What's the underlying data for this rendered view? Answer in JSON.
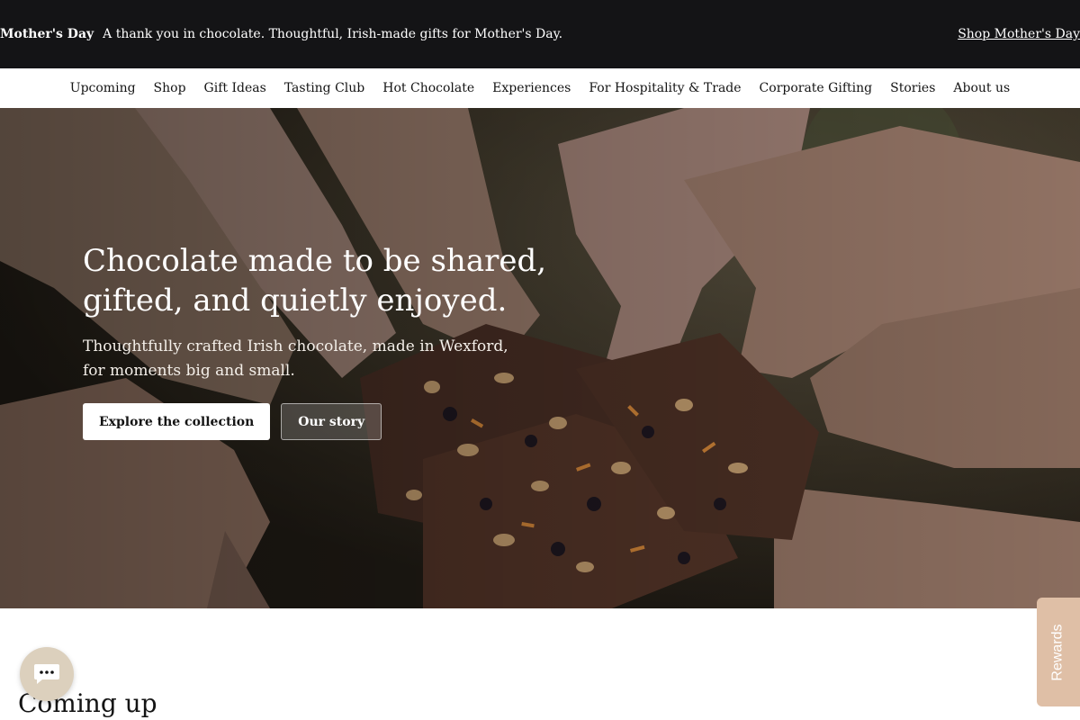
{
  "announcement": {
    "title": "Mother's Day",
    "text": "A thank you in chocolate. Thoughtful, Irish-made gifts for Mother's Day.",
    "link": "Shop Mother's Day",
    "background": "#141416"
  },
  "nav": {
    "items": [
      {
        "label": "Upcoming"
      },
      {
        "label": "Shop"
      },
      {
        "label": "Gift Ideas"
      },
      {
        "label": "Tasting Club"
      },
      {
        "label": "Hot Chocolate"
      },
      {
        "label": "Experiences"
      },
      {
        "label": "For Hospitality & Trade"
      },
      {
        "label": "Corporate Gifting"
      },
      {
        "label": "Stories"
      },
      {
        "label": "About us"
      }
    ]
  },
  "hero": {
    "heading_line1": "Chocolate made to be shared,",
    "heading_line2": "gifted, and quietly enjoyed.",
    "subtitle_line1": "Thoughtfully crafted Irish chocolate, made in Wexford,",
    "subtitle_line2": "for moments big and small.",
    "primary_button": "Explore the collection",
    "secondary_button": "Our story"
  },
  "section": {
    "title": "Coming up"
  },
  "chat": {
    "icon": "chat-bubble-icon",
    "color": "#dcd0bd"
  },
  "rewards": {
    "label": "Rewards",
    "color": "#dfbfa6"
  }
}
